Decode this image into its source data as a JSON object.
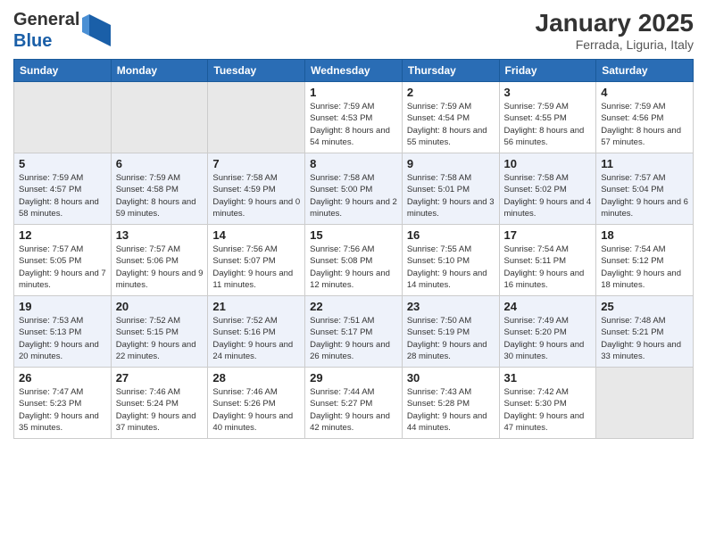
{
  "header": {
    "logo_general": "General",
    "logo_blue": "Blue",
    "month_title": "January 2025",
    "location": "Ferrada, Liguria, Italy"
  },
  "weekdays": [
    "Sunday",
    "Monday",
    "Tuesday",
    "Wednesday",
    "Thursday",
    "Friday",
    "Saturday"
  ],
  "weeks": [
    [
      {
        "day": "",
        "empty": true
      },
      {
        "day": "",
        "empty": true
      },
      {
        "day": "",
        "empty": true
      },
      {
        "day": "1",
        "rise": "7:59 AM",
        "set": "4:53 PM",
        "daylight": "8 hours and 54 minutes."
      },
      {
        "day": "2",
        "rise": "7:59 AM",
        "set": "4:54 PM",
        "daylight": "8 hours and 55 minutes."
      },
      {
        "day": "3",
        "rise": "7:59 AM",
        "set": "4:55 PM",
        "daylight": "8 hours and 56 minutes."
      },
      {
        "day": "4",
        "rise": "7:59 AM",
        "set": "4:56 PM",
        "daylight": "8 hours and 57 minutes."
      }
    ],
    [
      {
        "day": "5",
        "rise": "7:59 AM",
        "set": "4:57 PM",
        "daylight": "8 hours and 58 minutes."
      },
      {
        "day": "6",
        "rise": "7:59 AM",
        "set": "4:58 PM",
        "daylight": "8 hours and 59 minutes."
      },
      {
        "day": "7",
        "rise": "7:58 AM",
        "set": "4:59 PM",
        "daylight": "9 hours and 0 minutes."
      },
      {
        "day": "8",
        "rise": "7:58 AM",
        "set": "5:00 PM",
        "daylight": "9 hours and 2 minutes."
      },
      {
        "day": "9",
        "rise": "7:58 AM",
        "set": "5:01 PM",
        "daylight": "9 hours and 3 minutes."
      },
      {
        "day": "10",
        "rise": "7:58 AM",
        "set": "5:02 PM",
        "daylight": "9 hours and 4 minutes."
      },
      {
        "day": "11",
        "rise": "7:57 AM",
        "set": "5:04 PM",
        "daylight": "9 hours and 6 minutes."
      }
    ],
    [
      {
        "day": "12",
        "rise": "7:57 AM",
        "set": "5:05 PM",
        "daylight": "9 hours and 7 minutes."
      },
      {
        "day": "13",
        "rise": "7:57 AM",
        "set": "5:06 PM",
        "daylight": "9 hours and 9 minutes."
      },
      {
        "day": "14",
        "rise": "7:56 AM",
        "set": "5:07 PM",
        "daylight": "9 hours and 11 minutes."
      },
      {
        "day": "15",
        "rise": "7:56 AM",
        "set": "5:08 PM",
        "daylight": "9 hours and 12 minutes."
      },
      {
        "day": "16",
        "rise": "7:55 AM",
        "set": "5:10 PM",
        "daylight": "9 hours and 14 minutes."
      },
      {
        "day": "17",
        "rise": "7:54 AM",
        "set": "5:11 PM",
        "daylight": "9 hours and 16 minutes."
      },
      {
        "day": "18",
        "rise": "7:54 AM",
        "set": "5:12 PM",
        "daylight": "9 hours and 18 minutes."
      }
    ],
    [
      {
        "day": "19",
        "rise": "7:53 AM",
        "set": "5:13 PM",
        "daylight": "9 hours and 20 minutes."
      },
      {
        "day": "20",
        "rise": "7:52 AM",
        "set": "5:15 PM",
        "daylight": "9 hours and 22 minutes."
      },
      {
        "day": "21",
        "rise": "7:52 AM",
        "set": "5:16 PM",
        "daylight": "9 hours and 24 minutes."
      },
      {
        "day": "22",
        "rise": "7:51 AM",
        "set": "5:17 PM",
        "daylight": "9 hours and 26 minutes."
      },
      {
        "day": "23",
        "rise": "7:50 AM",
        "set": "5:19 PM",
        "daylight": "9 hours and 28 minutes."
      },
      {
        "day": "24",
        "rise": "7:49 AM",
        "set": "5:20 PM",
        "daylight": "9 hours and 30 minutes."
      },
      {
        "day": "25",
        "rise": "7:48 AM",
        "set": "5:21 PM",
        "daylight": "9 hours and 33 minutes."
      }
    ],
    [
      {
        "day": "26",
        "rise": "7:47 AM",
        "set": "5:23 PM",
        "daylight": "9 hours and 35 minutes."
      },
      {
        "day": "27",
        "rise": "7:46 AM",
        "set": "5:24 PM",
        "daylight": "9 hours and 37 minutes."
      },
      {
        "day": "28",
        "rise": "7:46 AM",
        "set": "5:26 PM",
        "daylight": "9 hours and 40 minutes."
      },
      {
        "day": "29",
        "rise": "7:44 AM",
        "set": "5:27 PM",
        "daylight": "9 hours and 42 minutes."
      },
      {
        "day": "30",
        "rise": "7:43 AM",
        "set": "5:28 PM",
        "daylight": "9 hours and 44 minutes."
      },
      {
        "day": "31",
        "rise": "7:42 AM",
        "set": "5:30 PM",
        "daylight": "9 hours and 47 minutes."
      },
      {
        "day": "",
        "empty": true
      }
    ]
  ],
  "labels": {
    "sunrise": "Sunrise:",
    "sunset": "Sunset:",
    "daylight": "Daylight:"
  }
}
